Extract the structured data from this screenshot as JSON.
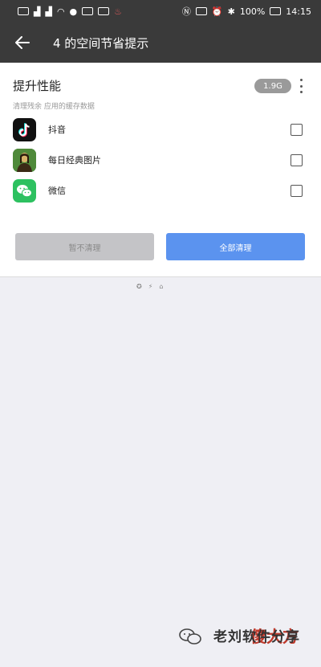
{
  "status_bar": {
    "battery": "100%",
    "time": "14:15"
  },
  "header": {
    "title": "4 的空间节省提示"
  },
  "section": {
    "title": "提升性能",
    "subtitle": "清理残余 应用的缓存数据",
    "pill": "1.9G"
  },
  "apps": [
    {
      "name": "抖音",
      "icon": "tiktok-icon",
      "color": "#111111"
    },
    {
      "name": "每日经典图片",
      "icon": "mona-lisa-icon",
      "color": "#2d7d3a"
    },
    {
      "name": "微信",
      "icon": "wechat-icon",
      "color": "#2dc160"
    }
  ],
  "buttons": {
    "cancel": "暂不清理",
    "confirm": "全部清理"
  },
  "footer": {
    "icons": [
      "✪",
      "⚡",
      "⌂"
    ]
  },
  "watermark": {
    "top_text": "傻大方",
    "bottom_text": "老刘软件分享"
  },
  "colors": {
    "header_bg": "#3a3a3a",
    "accent": "#5b93ef",
    "watermark_red": "#c0392b"
  }
}
